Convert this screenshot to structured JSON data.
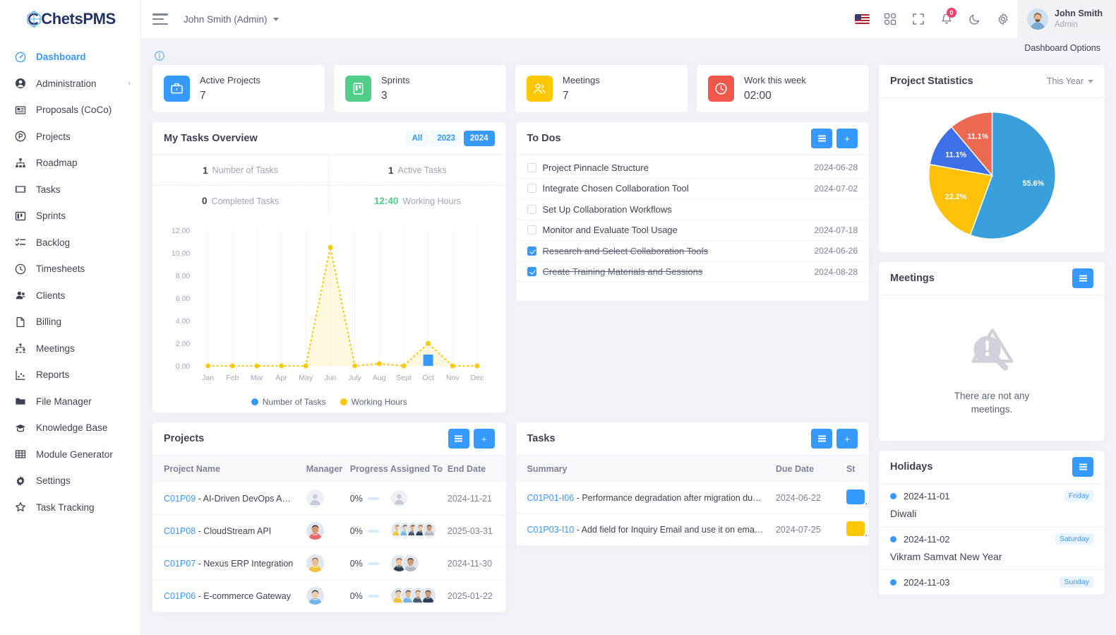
{
  "brand": {
    "name_dark": "C",
    "name_rest": "hetsPMS",
    "logo_icon": "chets-logo-icon"
  },
  "sidebar": {
    "items": [
      {
        "label": "Dashboard",
        "icon": "dashboard-icon",
        "active": true
      },
      {
        "label": "Administration",
        "icon": "user-circle-icon",
        "caret": "›"
      },
      {
        "label": "Proposals (CoCo)",
        "icon": "proposal-icon"
      },
      {
        "label": "Projects",
        "icon": "projects-icon"
      },
      {
        "label": "Roadmap",
        "icon": "roadmap-icon"
      },
      {
        "label": "Tasks",
        "icon": "tasks-icon"
      },
      {
        "label": "Sprints",
        "icon": "sprints-icon"
      },
      {
        "label": "Backlog",
        "icon": "backlog-icon"
      },
      {
        "label": "Timesheets",
        "icon": "clock-icon"
      },
      {
        "label": "Clients",
        "icon": "clients-icon"
      },
      {
        "label": "Billing",
        "icon": "billing-icon"
      },
      {
        "label": "Meetings",
        "icon": "meetings-icon"
      },
      {
        "label": "Reports",
        "icon": "reports-icon"
      },
      {
        "label": "File Manager",
        "icon": "folder-icon"
      },
      {
        "label": "Knowledge Base",
        "icon": "graduation-cap-icon"
      },
      {
        "label": "Module Generator",
        "icon": "grid-table-icon"
      },
      {
        "label": "Settings",
        "icon": "gear-icon"
      },
      {
        "label": "Task Tracking",
        "icon": "star-icon"
      }
    ]
  },
  "topbar": {
    "menu_toggle": "hamburger-icon",
    "user_switcher": "John Smith (Admin)",
    "icons": [
      "flag-us-icon",
      "apps-grid-icon",
      "fullscreen-icon",
      "bell-icon",
      "moon-icon",
      "gear-icon"
    ],
    "notification_count": "0",
    "profile": {
      "name": "John Smith",
      "role": "Admin"
    },
    "dashboard_options": "Dashboard Options"
  },
  "stats": [
    {
      "label": "Active Projects",
      "value": "7",
      "icon": "briefcase-icon",
      "color": "#3699ff"
    },
    {
      "label": "Sprints",
      "value": "3",
      "icon": "sprint-board-icon",
      "color": "#50cd89"
    },
    {
      "label": "Meetings",
      "value": "7",
      "icon": "people-icon",
      "color": "#ffc700"
    },
    {
      "label": "Work this week",
      "value": "02:00",
      "icon": "clock-icon",
      "color": "#f1574a"
    }
  ],
  "tasks_overview": {
    "title": "My Tasks Overview",
    "years": [
      {
        "label": "All",
        "active": false
      },
      {
        "label": "2023",
        "active": false
      },
      {
        "label": "2024",
        "active": true
      }
    ],
    "metrics": [
      {
        "value": "1",
        "label": "Number of Tasks",
        "green": false
      },
      {
        "value": "1",
        "label": "Active Tasks",
        "green": false
      },
      {
        "value": "0",
        "label": "Completed Tasks",
        "green": false
      },
      {
        "value": "12:40",
        "label": "Working Hours",
        "green": true
      }
    ]
  },
  "chart_data": {
    "type": "line",
    "title": "My Tasks Overview",
    "categories": [
      "Jan",
      "Feb",
      "Mar",
      "Apr",
      "May",
      "Jun",
      "July",
      "Aug",
      "Sept",
      "Oct",
      "Nov",
      "Dec"
    ],
    "series": [
      {
        "name": "Number of Tasks",
        "type": "bar",
        "color": "#3699ff",
        "values": [
          0,
          0,
          0,
          0,
          0,
          0,
          0,
          0,
          0,
          1,
          0,
          0
        ]
      },
      {
        "name": "Working Hours",
        "type": "area",
        "color": "#ffc700",
        "values": [
          0,
          0,
          0,
          0,
          0,
          10.5,
          0,
          0.2,
          0,
          2.0,
          0,
          0
        ]
      }
    ],
    "ytick_labels": [
      "0.00",
      "2.00",
      "4.00",
      "6.00",
      "8.00",
      "10.00",
      "12.00"
    ],
    "ylim": [
      0,
      12
    ],
    "xlabel": "",
    "ylabel": "",
    "grid": true,
    "legend": "bottom"
  },
  "todos": {
    "title": "To Dos",
    "menu_icon": "list-menu-icon",
    "add_icon": "plus-icon",
    "items": [
      {
        "text": "Project Pinnacle Structure",
        "date": "2024-06-28",
        "done": false
      },
      {
        "text": "Integrate Chosen Collaboration Tool",
        "date": "2024-07-02",
        "done": false
      },
      {
        "text": "Set Up Collaboration Workflows",
        "date": "",
        "done": false
      },
      {
        "text": "Monitor and Evaluate Tool Usage",
        "date": "2024-07-18",
        "done": false
      },
      {
        "text": "Research and Select Collaboration Tools",
        "date": "2024-06-26",
        "done": true
      },
      {
        "text": "Create Training Materials and Sessions",
        "date": "2024-08-28",
        "done": true
      }
    ]
  },
  "project_statistics": {
    "title": "Project Statistics",
    "period": "This Year",
    "chart": {
      "type": "pie",
      "slices": [
        {
          "label": "55.6%",
          "value": 55.6,
          "color": "#3aa0dc"
        },
        {
          "label": "22.2%",
          "value": 22.2,
          "color": "#ffc107"
        },
        {
          "label": "11.1%",
          "value": 11.1,
          "color": "#3c6fe8"
        },
        {
          "label": "11.1%",
          "value": 11.1,
          "color": "#ec6a52"
        }
      ]
    }
  },
  "meetings_panel": {
    "title": "Meetings",
    "menu_icon": "list-menu-icon",
    "empty_text": "There are not any meetings.",
    "empty_icon": "no-results-icon"
  },
  "holidays": {
    "title": "Holidays",
    "menu_icon": "list-menu-icon",
    "items": [
      {
        "date": "2024-11-01",
        "day": "Friday",
        "name": "Diwali"
      },
      {
        "date": "2024-11-02",
        "day": "Saturday",
        "name": "Vikram Samvat New Year"
      },
      {
        "date": "2024-11-03",
        "day": "Sunday",
        "name": ""
      }
    ]
  },
  "projects_panel": {
    "title": "Projects",
    "menu_icon": "list-menu-icon",
    "add_icon": "plus-icon",
    "columns": [
      "Project Name",
      "Manager",
      "Progress",
      "Assigned To",
      "End Date"
    ],
    "rows": [
      {
        "code": "C01P09",
        "name": "AI-Driven DevOps Automation",
        "manager_count": 1,
        "manager_placeholder": true,
        "progress": "0%",
        "assignees": 1,
        "assignees_placeholder": true,
        "end_date": "2024-11-21"
      },
      {
        "code": "C01P08",
        "name": "CloudStream API",
        "manager_count": 1,
        "manager_placeholder": false,
        "progress": "0%",
        "assignees": 5,
        "assignees_placeholder": false,
        "end_date": "2025-03-31"
      },
      {
        "code": "C01P07",
        "name": "Nexus ERP Integration",
        "manager_count": 1,
        "manager_placeholder": false,
        "progress": "0%",
        "assignees": 2,
        "assignees_placeholder": false,
        "end_date": "2024-11-30"
      },
      {
        "code": "C01P06",
        "name": "E-commerce Gateway",
        "manager_count": 1,
        "manager_placeholder": false,
        "progress": "0%",
        "assignees": 4,
        "assignees_placeholder": false,
        "end_date": "2025-01-22"
      }
    ]
  },
  "tasks_panel": {
    "title": "Tasks",
    "menu_icon": "list-menu-icon",
    "add_icon": "plus-icon",
    "columns": [
      "Summary",
      "Due Date",
      "St"
    ],
    "rows": [
      {
        "code": "C01P01-I06",
        "summary": "Performance degradation after migration due to improper reso...",
        "due_date": "2024-06-22",
        "status_color": "#3699ff"
      },
      {
        "code": "C01P03-I10",
        "summary": "Add field for Inquiry Email and use it on email sending",
        "due_date": "2024-07-25",
        "status_color": "#ffc700"
      }
    ]
  }
}
